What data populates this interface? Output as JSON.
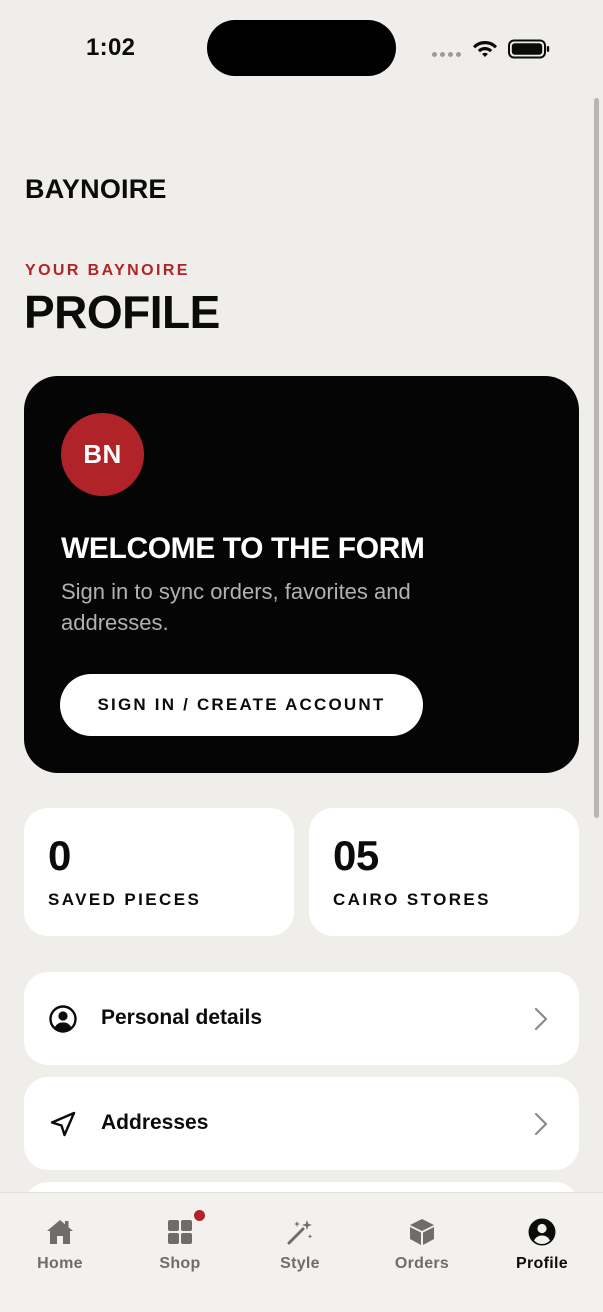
{
  "status_bar": {
    "time": "1:02"
  },
  "header": {
    "brand": "BAYNOIRE",
    "eyebrow": "YOUR BAYNOIRE",
    "title": "PROFILE"
  },
  "welcome_card": {
    "avatar_initials": "BN",
    "title": "WELCOME TO THE FORM",
    "subtitle": "Sign in to sync orders, favorites and addresses.",
    "button_label": "SIGN IN / CREATE ACCOUNT"
  },
  "stats": [
    {
      "value": "0",
      "label": "SAVED PIECES"
    },
    {
      "value": "05",
      "label": "CAIRO STORES"
    }
  ],
  "menu": [
    {
      "label": "Personal details",
      "icon": "user-circle-icon"
    },
    {
      "label": "Addresses",
      "icon": "navigation-arrow-icon"
    }
  ],
  "tabs": [
    {
      "label": "Home",
      "icon": "home-icon",
      "active": false
    },
    {
      "label": "Shop",
      "icon": "grid-icon",
      "active": false,
      "badge": true
    },
    {
      "label": "Style",
      "icon": "magic-wand-icon",
      "active": false
    },
    {
      "label": "Orders",
      "icon": "box-icon",
      "active": false
    },
    {
      "label": "Profile",
      "icon": "person-icon",
      "active": true
    }
  ],
  "colors": {
    "background": "#f0eeea",
    "accent": "#b02329",
    "card_dark": "#050505",
    "surface": "#ffffff",
    "muted_text": "#b3b1ad",
    "tab_inactive": "#6f6d69"
  }
}
